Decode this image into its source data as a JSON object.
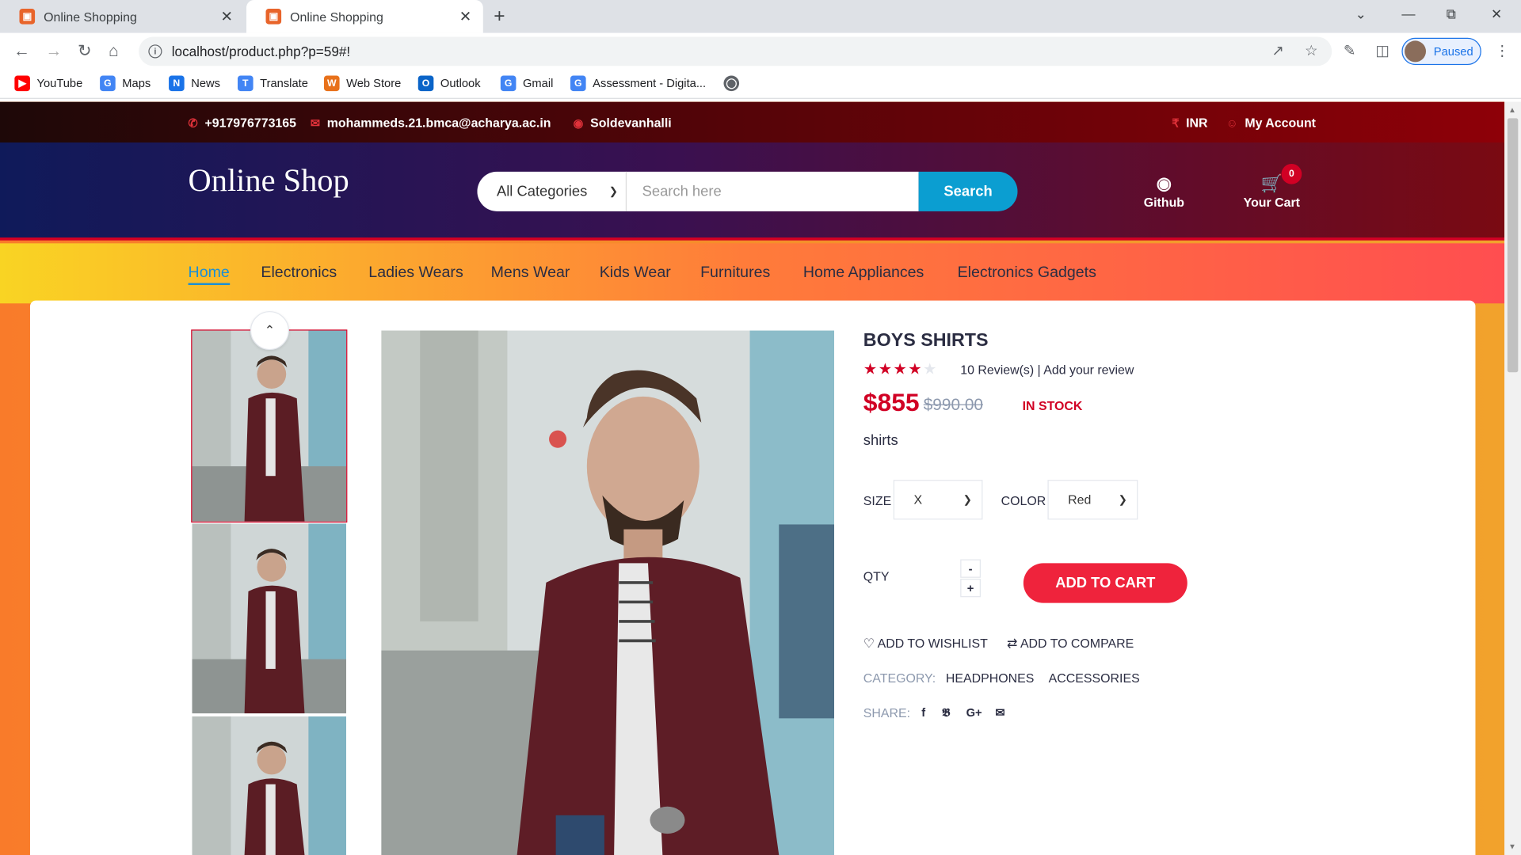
{
  "browser": {
    "tabs": [
      {
        "title": "Online Shopping"
      },
      {
        "title": "Online Shopping"
      }
    ],
    "url": "localhost/product.php?p=59#!",
    "profile_label": "Paused",
    "bookmarks": [
      {
        "label": "YouTube",
        "icon": "youtube-icon",
        "color": "#ff0000"
      },
      {
        "label": "Maps",
        "icon": "google-icon",
        "color": "#4285f4"
      },
      {
        "label": "News",
        "icon": "news-icon",
        "color": "#1a73e8"
      },
      {
        "label": "Translate",
        "icon": "translate-icon",
        "color": "#4285f4"
      },
      {
        "label": "Web Store",
        "icon": "webstore-icon",
        "color": "#e8711a"
      },
      {
        "label": "Outlook",
        "icon": "outlook-icon",
        "color": "#0a64c8"
      },
      {
        "label": "Gmail",
        "icon": "google-icon",
        "color": "#4285f4"
      },
      {
        "label": "Assessment - Digita...",
        "icon": "google-icon",
        "color": "#4285f4"
      }
    ]
  },
  "topbar": {
    "phone": "+917976773165",
    "email": "mohammeds.21.bmca@acharya.ac.in",
    "location": "Soldevanhalli",
    "currency": "INR",
    "account": "My Account"
  },
  "header": {
    "logo": "Online Shop",
    "category_selected": "All Categories",
    "search_placeholder": "Search here",
    "search_button": "Search",
    "github_label": "Github",
    "cart_label": "Your Cart",
    "cart_count": "0"
  },
  "nav": {
    "items": [
      "Home",
      "Electronics",
      "Ladies Wears",
      "Mens Wear",
      "Kids Wear",
      "Furnitures",
      "Home Appliances",
      "Electronics Gadgets"
    ]
  },
  "product": {
    "name": "BOYS SHIRTS",
    "rating": 4,
    "rating_max": 5,
    "reviews": "10 Review(s) | Add your review",
    "price": "$855",
    "old_price": "$990.00",
    "stock": "IN STOCK",
    "description": "shirts",
    "size_label": "SIZE",
    "size_value": "X",
    "color_label": "COLOR",
    "color_value": "Red",
    "qty_label": "QTY",
    "qty_minus": "-",
    "qty_plus": "+",
    "add_to_cart": "ADD TO CART",
    "wishlist": "ADD TO WISHLIST",
    "compare": "ADD TO COMPARE",
    "category_label": "CATEGORY:",
    "categories": [
      "HEADPHONES",
      "ACCESSORIES"
    ],
    "share_label": "SHARE:"
  },
  "colors": {
    "brand_red": "#d10024",
    "search_blue": "#0b9ed1",
    "cart_button": "#ef233c",
    "active_nav": "#1a8fd6"
  }
}
